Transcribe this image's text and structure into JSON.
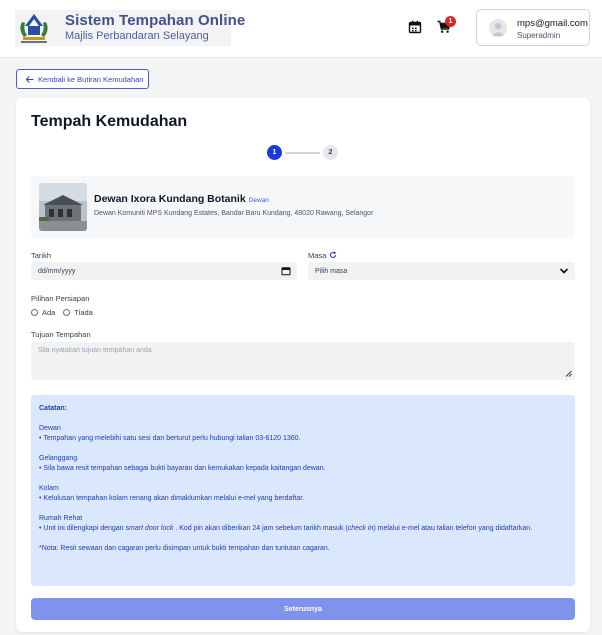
{
  "header": {
    "title": "Sistem Tempahan Online",
    "subtitle": "Majlis Perbandaran Selayang",
    "calendar_icon": "calendar-icon",
    "cart_icon": "cart-icon",
    "cart_count": "1",
    "user": {
      "email": "mps@gmail.com",
      "role": "Superadmin"
    }
  },
  "back_button": {
    "label": "Kembali ke Butiran Kemudahan",
    "icon": "arrow-left-icon"
  },
  "page_title": "Tempah Kemudahan",
  "stepper": {
    "steps": [
      "1",
      "2"
    ],
    "active": 1
  },
  "facility": {
    "name": "Dewan Ixora Kundang Botanik",
    "tag": "Dewan",
    "address": "Dewan Komuniti MPS Kundang Estates, Bandar Baru Kundang, 48020 Rawang, Selangor"
  },
  "form": {
    "date_label": "Tarikh",
    "date_value": "dd/mm/yyyy",
    "time_label": "Masa",
    "time_value": "Pilih masa",
    "prep_label": "Pilihan Persiapan",
    "prep_options": [
      "Ada",
      "Tiada"
    ],
    "purpose_label": "Tujuan Tempahan",
    "purpose_placeholder": "Sila nyatakan tujuan tempahan anda"
  },
  "notes": {
    "title": "Catatan:",
    "sections": [
      {
        "heading": "Dewan",
        "text": "• Tempahan yang melebihi satu sesi dan berturut perlu hubungi talian 03-6120 1360."
      },
      {
        "heading": "Gelanggang",
        "text": "• Sila bawa resit tempahan sebagai bukti bayaran dan kemukakan kepada kaitangan dewan."
      },
      {
        "heading": "Kolam",
        "text": "• Kelulusan tempahan kolam renang akan dimaklumkan melalui e-mel yang berdaftar."
      }
    ],
    "rumah_rehat": {
      "heading": "Rumah Rehat",
      "t1": "• Unit ini dilengkapi dengan ",
      "t2": "smart door lock",
      "t3": " . Kod pin akan diberikan 24 jam sebelum tarikh masuk (",
      "t4": "check in",
      "t5": ") melalui e-mel atau talian telefon yang didaftarkan."
    },
    "footnote": "*Nota: Resit sewaan dan cagaran perlu disimpan untuk bukti tempahan dan tuntutan cagaran."
  },
  "submit_label": "Seterusnya",
  "colors": {
    "primary": "#1d3bd6",
    "notes_bg": "#dbe7fd",
    "submit_bg": "#7f93ec",
    "badge": "#e02424"
  }
}
